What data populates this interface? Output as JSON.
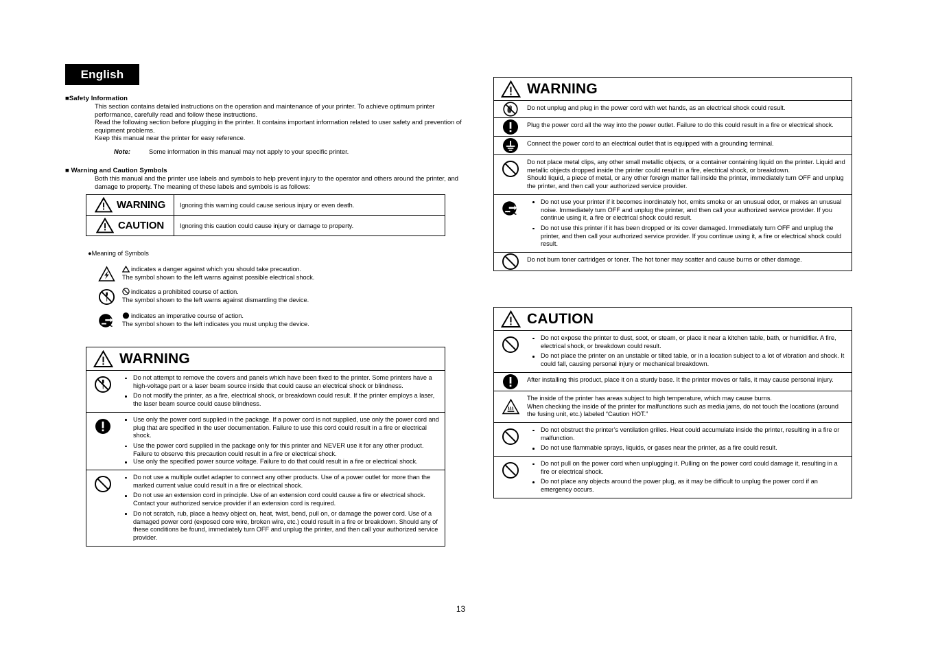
{
  "language_tab": "English",
  "page_number": "13",
  "sections": {
    "safety_information": {
      "heading": "Safety Information",
      "paragraphs": [
        "This section contains detailed instructions on the operation and maintenance of your printer. To achieve optimum printer performance, carefully read and follow these instructions.",
        "Read the following section before plugging in the printer. It contains important information related to user safety and prevention of equipment problems.",
        "Keep this manual near the printer for easy reference."
      ],
      "note_label": "Note:",
      "note_text": "Some information in this manual may not apply to your specific printer."
    },
    "warning_caution_symbols": {
      "heading": "Warning and Caution Symbols",
      "intro": "Both this manual and the printer use labels and symbols to help prevent injury to the operator and others around the printer, and damage to property. The meaning of these labels and symbols is as follows:",
      "table": [
        {
          "icon": "warning-triangle-icon",
          "label": "WARNING",
          "description": "Ignoring this warning could cause serious injury or even death."
        },
        {
          "icon": "warning-triangle-icon",
          "label": "CAUTION",
          "description": "Ignoring this caution could cause injury or damage to property."
        }
      ]
    },
    "meaning_of_symbols": {
      "title": "Meaning of Symbols",
      "items": [
        {
          "icon": "electric-shock-triangle-icon",
          "inline_icon": "triangle-icon",
          "line1": "indicates a danger against which you should take precaution.",
          "line2": "The symbol shown to the left warns against possible electrical shock."
        },
        {
          "icon": "no-disassembly-icon",
          "inline_icon": "prohibition-circle-icon",
          "line1": "indicates a prohibited course of action.",
          "line2": "The symbol shown to the left warns against dismantling the device."
        },
        {
          "icon": "unplug-device-icon",
          "inline_icon": "filled-circle-icon",
          "line1": "indicates an imperative course of action.",
          "line2": "The symbol shown to the left indicates you must unplug the device."
        }
      ]
    }
  },
  "warning_box_left": {
    "title": "WARNING",
    "title_icon": "warning-triangle-icon",
    "rows": [
      {
        "icon": "no-disassembly-icon",
        "bullets": [
          "Do not attempt to remove the covers and panels which have been fixed to the printer. Some printers have a high-voltage part or a laser beam source inside that could cause an electrical shock or blindness.",
          "Do not modify the printer, as a fire, electrical shock, or breakdown could result. If the printer employs a laser, the laser beam source could cause blindness."
        ]
      },
      {
        "icon": "imperative-exclamation-icon",
        "bullets": [
          "Use only the power cord supplied in the package. If a power cord is not supplied, use only the power cord and plug that are specified in the user documentation. Failure to use this cord could result in a fire or electrical shock.",
          "Use the power cord supplied in the package only for this printer and NEVER use it for any other product. Failure to observe this precaution could result in a fire or electrical shock.",
          "Use only the specified power source voltage. Failure to do that could result in a fire or electrical shock."
        ]
      },
      {
        "icon": "prohibition-circle-icon",
        "bullets": [
          "Do not use a multiple outlet adapter to connect any other products. Use of a power outlet for more than the marked current value could result in a fire or electrical shock.",
          "Do not use an extension cord in principle. Use of an extension cord could cause a fire or electrical shock. Contact your authorized service provider if an extension cord is required.",
          "Do not scratch, rub, place a heavy object on, heat, twist, bend, pull on, or damage the power cord. Use of a damaged power cord (exposed core wire, broken wire, etc.) could result in a fire or breakdown. Should any of these conditions be found, immediately turn OFF and unplug the printer, and then call your authorized service provider."
        ]
      }
    ]
  },
  "warning_box_right": {
    "title": "WARNING",
    "title_icon": "warning-triangle-icon",
    "rows": [
      {
        "icon": "wet-hands-prohibited-icon",
        "paragraphs": [
          "Do not unplug and plug in the power cord with wet hands, as an electrical shock could result."
        ]
      },
      {
        "icon": "imperative-exclamation-icon",
        "paragraphs": [
          "Plug the power cord all the way into the power outlet. Failure to do this could result in a fire or electrical shock."
        ]
      },
      {
        "icon": "grounding-terminal-icon",
        "paragraphs": [
          "Connect the power cord to an electrical outlet that is equipped with a grounding terminal."
        ]
      },
      {
        "icon": "prohibition-circle-icon",
        "paragraphs": [
          "Do not place metal clips, any other small metallic objects, or a container containing liquid on the printer. Liquid and metallic objects dropped inside the printer could result in a fire, electrical shock, or breakdown.",
          "Should liquid, a piece of metal, or any other foreign matter fall inside the printer, immediately turn OFF and unplug the printer, and then call your authorized service provider."
        ]
      },
      {
        "icon": "unplug-device-icon",
        "bullets": [
          "Do not use your printer if it becomes inordinately hot, emits smoke or an unusual odor, or makes an unusual noise. Immediately turn OFF and unplug the printer, and then call your authorized service provider. If you continue using it, a fire or electrical shock could result.",
          "Do not use this printer if it has been dropped or its cover damaged. Immediately turn OFF and unplug the printer, and then call your authorized service provider. If you continue using it, a fire or electrical shock could result."
        ]
      },
      {
        "icon": "prohibition-circle-icon",
        "paragraphs": [
          "Do not burn toner cartridges or toner. The hot toner may scatter and cause burns or other damage."
        ]
      }
    ]
  },
  "caution_box_right": {
    "title": "CAUTION",
    "title_icon": "warning-triangle-icon",
    "rows": [
      {
        "icon": "prohibition-circle-icon",
        "bullets": [
          "Do not expose the printer to dust, soot, or steam, or place it near a kitchen table, bath, or humidifier. A fire, electrical shock, or breakdown could result.",
          "Do not place the printer on an unstable or tilted table, or in a location subject to a lot of vibration and shock. It could fall, causing personal injury or mechanical breakdown."
        ]
      },
      {
        "icon": "imperative-exclamation-icon",
        "paragraphs": [
          "After installing this product, place it on a sturdy base. It the printer moves or falls, it may cause personal injury."
        ]
      },
      {
        "icon": "hot-surface-triangle-icon",
        "paragraphs": [
          "The inside of the printer has areas subject to high temperature, which may cause burns.",
          "When checking the inside of the printer for malfunctions such as media jams, do not touch the locations (around the fusing unit, etc.) labeled “Caution HOT.”"
        ]
      },
      {
        "icon": "prohibition-circle-icon",
        "bullets": [
          "Do not obstruct the printer’s ventilation grilles. Heat could accumulate inside the printer, resulting in a fire or malfunction.",
          "Do not use flammable sprays, liquids, or gases near the printer, as a fire could result."
        ]
      },
      {
        "icon": "prohibition-circle-icon",
        "bullets": [
          "Do not pull on the power cord when unplugging it. Pulling on the power cord could damage it, resulting in a fire or electrical shock.",
          "Do not place any objects around the power plug, as it may be difficult to unplug the power cord if an emergency occurs."
        ]
      }
    ]
  },
  "colors": {
    "ink": "#000000",
    "paper": "#ffffff"
  }
}
